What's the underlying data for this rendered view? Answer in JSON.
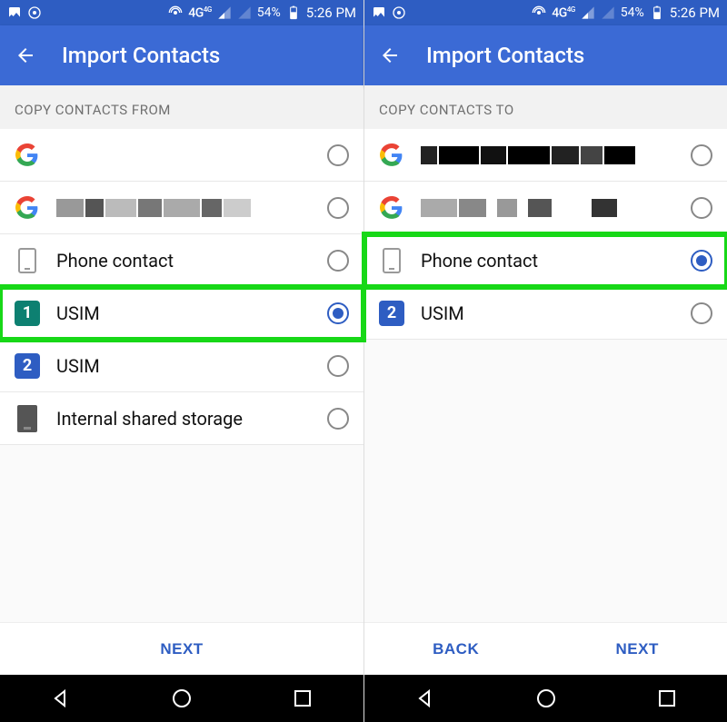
{
  "status": {
    "network_label": "4G",
    "network_sup": "4G",
    "battery_pct": "54%",
    "time": "5:26 PM"
  },
  "left": {
    "title": "Import Contacts",
    "section": "COPY CONTACTS FROM",
    "items": [
      {
        "icon": "google",
        "label": "",
        "redacted": false,
        "selected": false,
        "highlight": false
      },
      {
        "icon": "google",
        "label": "",
        "redacted": true,
        "selected": false,
        "highlight": false
      },
      {
        "icon": "phone",
        "label": "Phone contact",
        "selected": false,
        "highlight": false
      },
      {
        "icon": "sim1",
        "label": "USIM",
        "selected": true,
        "highlight": true
      },
      {
        "icon": "sim2",
        "label": "USIM",
        "selected": false,
        "highlight": false
      },
      {
        "icon": "storage",
        "label": "Internal shared storage",
        "selected": false,
        "highlight": false
      }
    ],
    "actions": {
      "next": "NEXT"
    }
  },
  "right": {
    "title": "Import Contacts",
    "section": "COPY CONTACTS TO",
    "items": [
      {
        "icon": "google",
        "label": "",
        "redacted": true,
        "selected": false,
        "highlight": false
      },
      {
        "icon": "google",
        "label": "",
        "redacted": true,
        "selected": false,
        "highlight": false
      },
      {
        "icon": "phone",
        "label": "Phone contact",
        "selected": true,
        "highlight": true
      },
      {
        "icon": "sim2",
        "label": "USIM",
        "selected": false,
        "highlight": false
      }
    ],
    "actions": {
      "back": "BACK",
      "next": "NEXT"
    }
  }
}
